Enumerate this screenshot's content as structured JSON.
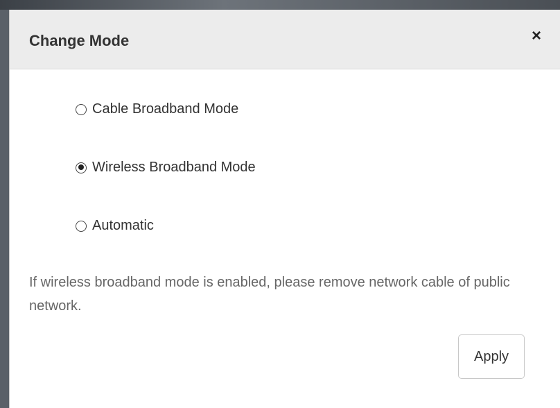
{
  "dialog": {
    "title": "Change Mode",
    "close_glyph": "×",
    "options": [
      {
        "label": "Cable Broadband Mode",
        "selected": false
      },
      {
        "label": "Wireless Broadband Mode",
        "selected": true
      },
      {
        "label": "Automatic",
        "selected": false
      }
    ],
    "note": "If wireless broadband mode is enabled, please remove network cable of public network.",
    "apply_label": "Apply"
  },
  "colors": {
    "header_bg": "#ececec",
    "text": "#333333",
    "note_text": "#666666",
    "button_border": "#c8c8c8"
  },
  "icons": {
    "close": "close-icon",
    "radio_unchecked": "radio-unchecked-icon",
    "radio_checked": "radio-checked-icon"
  }
}
